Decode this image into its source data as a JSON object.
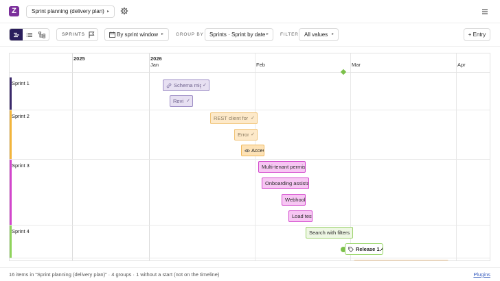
{
  "app": {
    "logo_letter": "Z",
    "brand_color": "#7b2f9b"
  },
  "header": {
    "plan_name": "Sprint planning (delivery plan)",
    "caret": "▸"
  },
  "toolbar": {
    "sprints_label": "SPRINTS",
    "window_label": "By sprint window",
    "window_caret": "▸",
    "group_by_label": "GROUP BY",
    "group_by_value": "Sprints · Sprint by date",
    "group_by_caret": "▸",
    "filter_label": "FILTER",
    "filter_value": "All values",
    "filter_caret": "▸",
    "entry_label": "+ Entry"
  },
  "timeline": {
    "years": [
      "2025",
      "2026"
    ],
    "months": [
      "Jan",
      "Feb",
      "Mar",
      "Apr"
    ],
    "groups": [
      {
        "name": "Sprint 1",
        "color": "#3b2a6b"
      },
      {
        "name": "Sprint 2",
        "color": "#f2b53c"
      },
      {
        "name": "Sprint 3",
        "color": "#d246cc"
      },
      {
        "name": "Sprint 4",
        "color": "#8fd35b"
      }
    ],
    "items": [
      {
        "label": "Schema migration",
        "color": "purple",
        "status": "done",
        "icon": "link-icon"
      },
      {
        "label": "Review",
        "color": "purple",
        "status": "done"
      },
      {
        "label": "REST client for",
        "color": "orange",
        "status": "done"
      },
      {
        "label": "Errors",
        "color": "orange",
        "status": "done"
      },
      {
        "label": "Access",
        "color": "orange",
        "status": "active",
        "icon": "eye-icon"
      },
      {
        "label": "Multi-tenant permissions",
        "color": "pink"
      },
      {
        "label": "Onboarding assistant",
        "color": "pink"
      },
      {
        "label": "Webhooks",
        "color": "pink"
      },
      {
        "label": "Load testing",
        "color": "pink"
      },
      {
        "label": "Search with filters",
        "color": "green"
      }
    ],
    "release": {
      "label": "Release 1.4",
      "icon": "tag-icon"
    },
    "check_glyph": "✓"
  },
  "statusbar": {
    "summary": "16 items in “Sprint planning (delivery plan)” · 4 groups · 1 without a start (not on the timeline)",
    "plugins_link": "Plugins"
  }
}
